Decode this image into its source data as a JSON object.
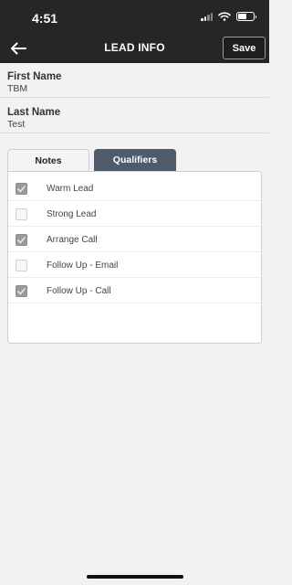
{
  "status_bar": {
    "time": "4:51"
  },
  "header": {
    "title": "LEAD INFO",
    "save_label": "Save"
  },
  "fields": [
    {
      "label": "First Name",
      "value": "TBM"
    },
    {
      "label": "Last Name",
      "value": "Test"
    }
  ],
  "tabs": [
    {
      "label": "Notes",
      "active": false
    },
    {
      "label": "Qualifiers",
      "active": true
    }
  ],
  "qualifiers": [
    {
      "label": "Warm Lead",
      "checked": true
    },
    {
      "label": "Strong Lead",
      "checked": false
    },
    {
      "label": "Arrange Call",
      "checked": true
    },
    {
      "label": "Follow Up - Email",
      "checked": false
    },
    {
      "label": "Follow Up - Call",
      "checked": true
    }
  ],
  "colors": {
    "header_bg": "#262626",
    "active_tab": "#4e5b6b",
    "checkbox_checked": "#9a9a9a"
  },
  "icons": {
    "back": "arrow-left-icon",
    "signal": "signal-icon",
    "wifi": "wifi-icon",
    "battery": "battery-icon"
  }
}
